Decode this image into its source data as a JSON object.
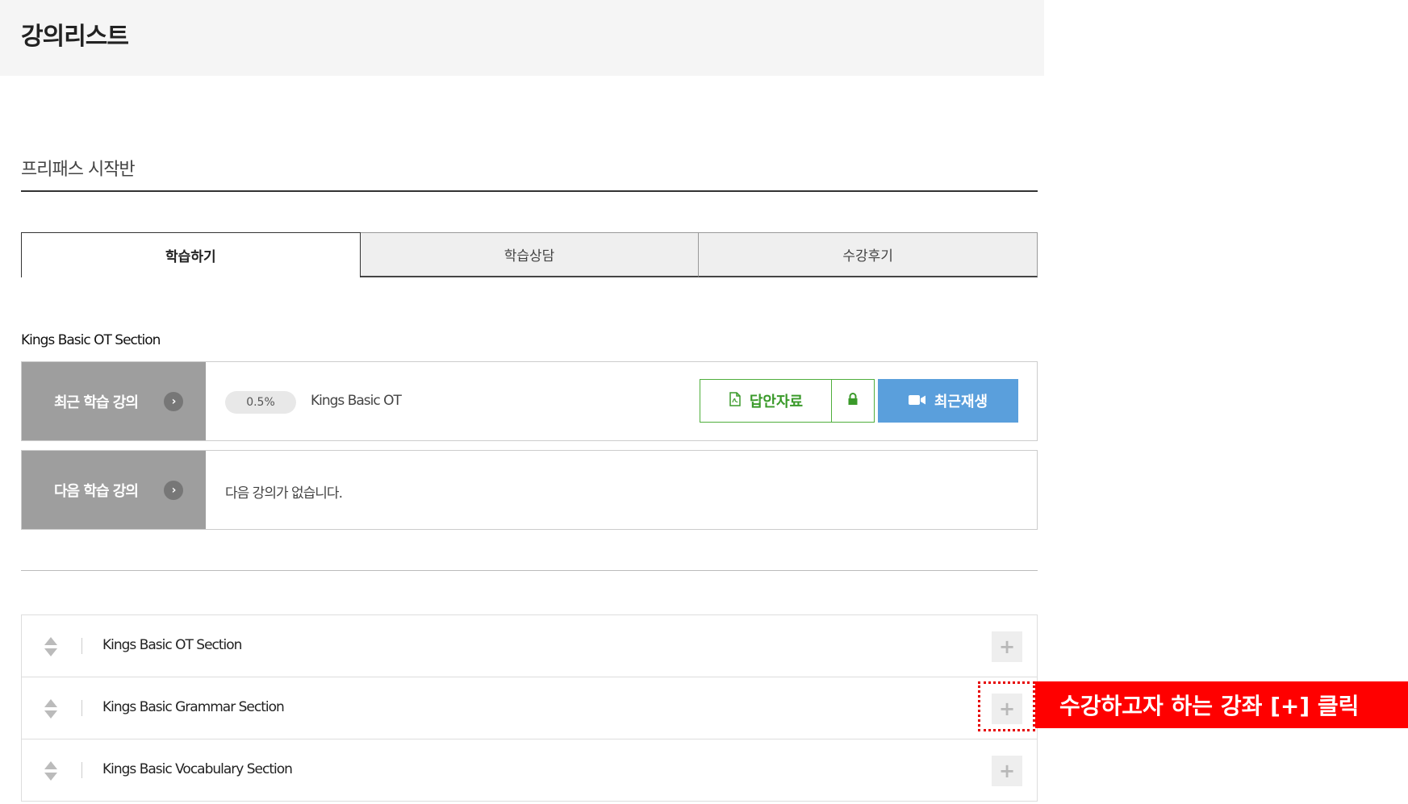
{
  "header": {
    "title": "강의리스트"
  },
  "course": {
    "title": "프리패스 시작반"
  },
  "tabs": [
    {
      "label": "학습하기",
      "active": true
    },
    {
      "label": "학습상담",
      "active": false
    },
    {
      "label": "수강후기",
      "active": false
    }
  ],
  "current_section": {
    "label": "Kings Basic OT Section"
  },
  "recent_lecture": {
    "heading": "최근 학습 강의",
    "progress": "0.5%",
    "name": "Kings Basic OT",
    "answer_button": "답안자료",
    "play_button": "최근재생"
  },
  "next_lecture": {
    "heading": "다음 학습 강의",
    "message": "다음 강의가 없습니다."
  },
  "sections": [
    {
      "name": "Kings Basic OT Section"
    },
    {
      "name": "Kings Basic Grammar Section"
    },
    {
      "name": "Kings Basic Vocabulary Section"
    }
  ],
  "annotation": {
    "callout": "수강하고자 하는 강좌 [+] 클릭"
  },
  "colors": {
    "accent_green": "#4fae3c",
    "accent_blue": "#5a9fdc",
    "callout_red": "#ff0000",
    "head_gray": "#9e9e9e"
  },
  "icons": {
    "arrow": "chevron-right-icon",
    "pdf": "pdf-file-icon",
    "lock": "lock-icon",
    "video": "video-camera-icon",
    "drag": "sort-handle-icon",
    "plus": "plus-icon"
  }
}
